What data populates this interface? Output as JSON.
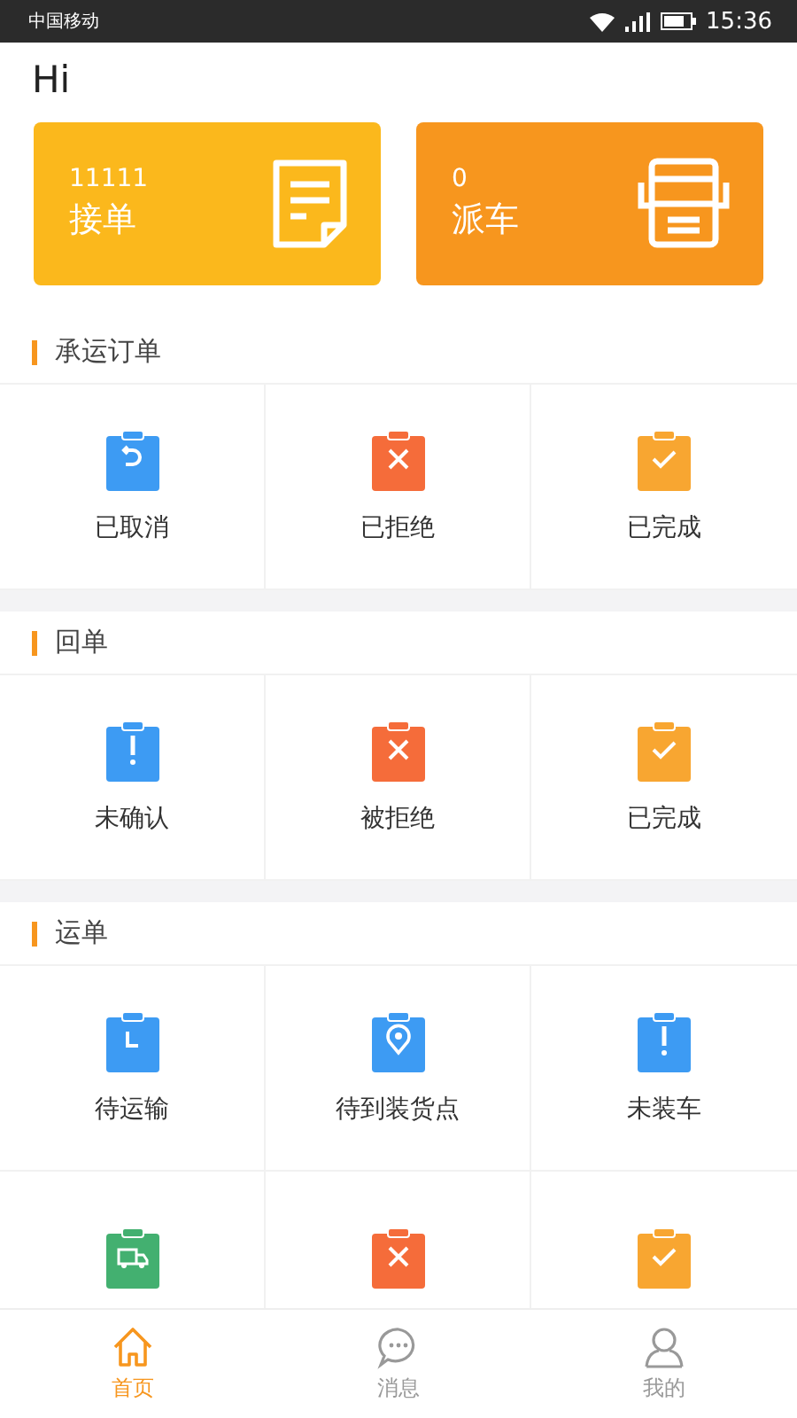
{
  "status_bar": {
    "carrier": "中国移动",
    "time": "15:36"
  },
  "greeting": "Hi",
  "cards": [
    {
      "kind": "order",
      "count": "11111",
      "label": "接单",
      "color": "#fbb81c"
    },
    {
      "kind": "bus",
      "count": "0",
      "label": "派车",
      "color": "#f7961e"
    }
  ],
  "sections": [
    {
      "title": "承运订单",
      "items": [
        {
          "label": "已取消",
          "kind": "undo",
          "color": "#3d9bf3"
        },
        {
          "label": "已拒绝",
          "kind": "cross",
          "color": "#f56c3a"
        },
        {
          "label": "已完成",
          "kind": "check",
          "color": "#f8a631"
        }
      ]
    },
    {
      "title": "回单",
      "items": [
        {
          "label": "未确认",
          "kind": "alert",
          "color": "#3d9bf3"
        },
        {
          "label": "被拒绝",
          "kind": "cross",
          "color": "#f56c3a"
        },
        {
          "label": "已完成",
          "kind": "check",
          "color": "#f8a631"
        }
      ]
    },
    {
      "title": "运单",
      "items": [
        {
          "label": "待运输",
          "kind": "clock",
          "color": "#3d9bf3"
        },
        {
          "label": "待到装货点",
          "kind": "pin",
          "color": "#3d9bf3"
        },
        {
          "label": "未装车",
          "kind": "alert",
          "color": "#3d9bf3"
        },
        {
          "kind": "truck",
          "color": "#43b070"
        },
        {
          "kind": "cross",
          "color": "#f56c3a"
        },
        {
          "kind": "check",
          "color": "#f8a631"
        }
      ]
    }
  ],
  "tab_bar": [
    {
      "label": "首页",
      "kind": "home",
      "selected": true
    },
    {
      "label": "消息",
      "kind": "chat",
      "selected": false
    },
    {
      "label": "我的",
      "kind": "person",
      "selected": false
    }
  ]
}
